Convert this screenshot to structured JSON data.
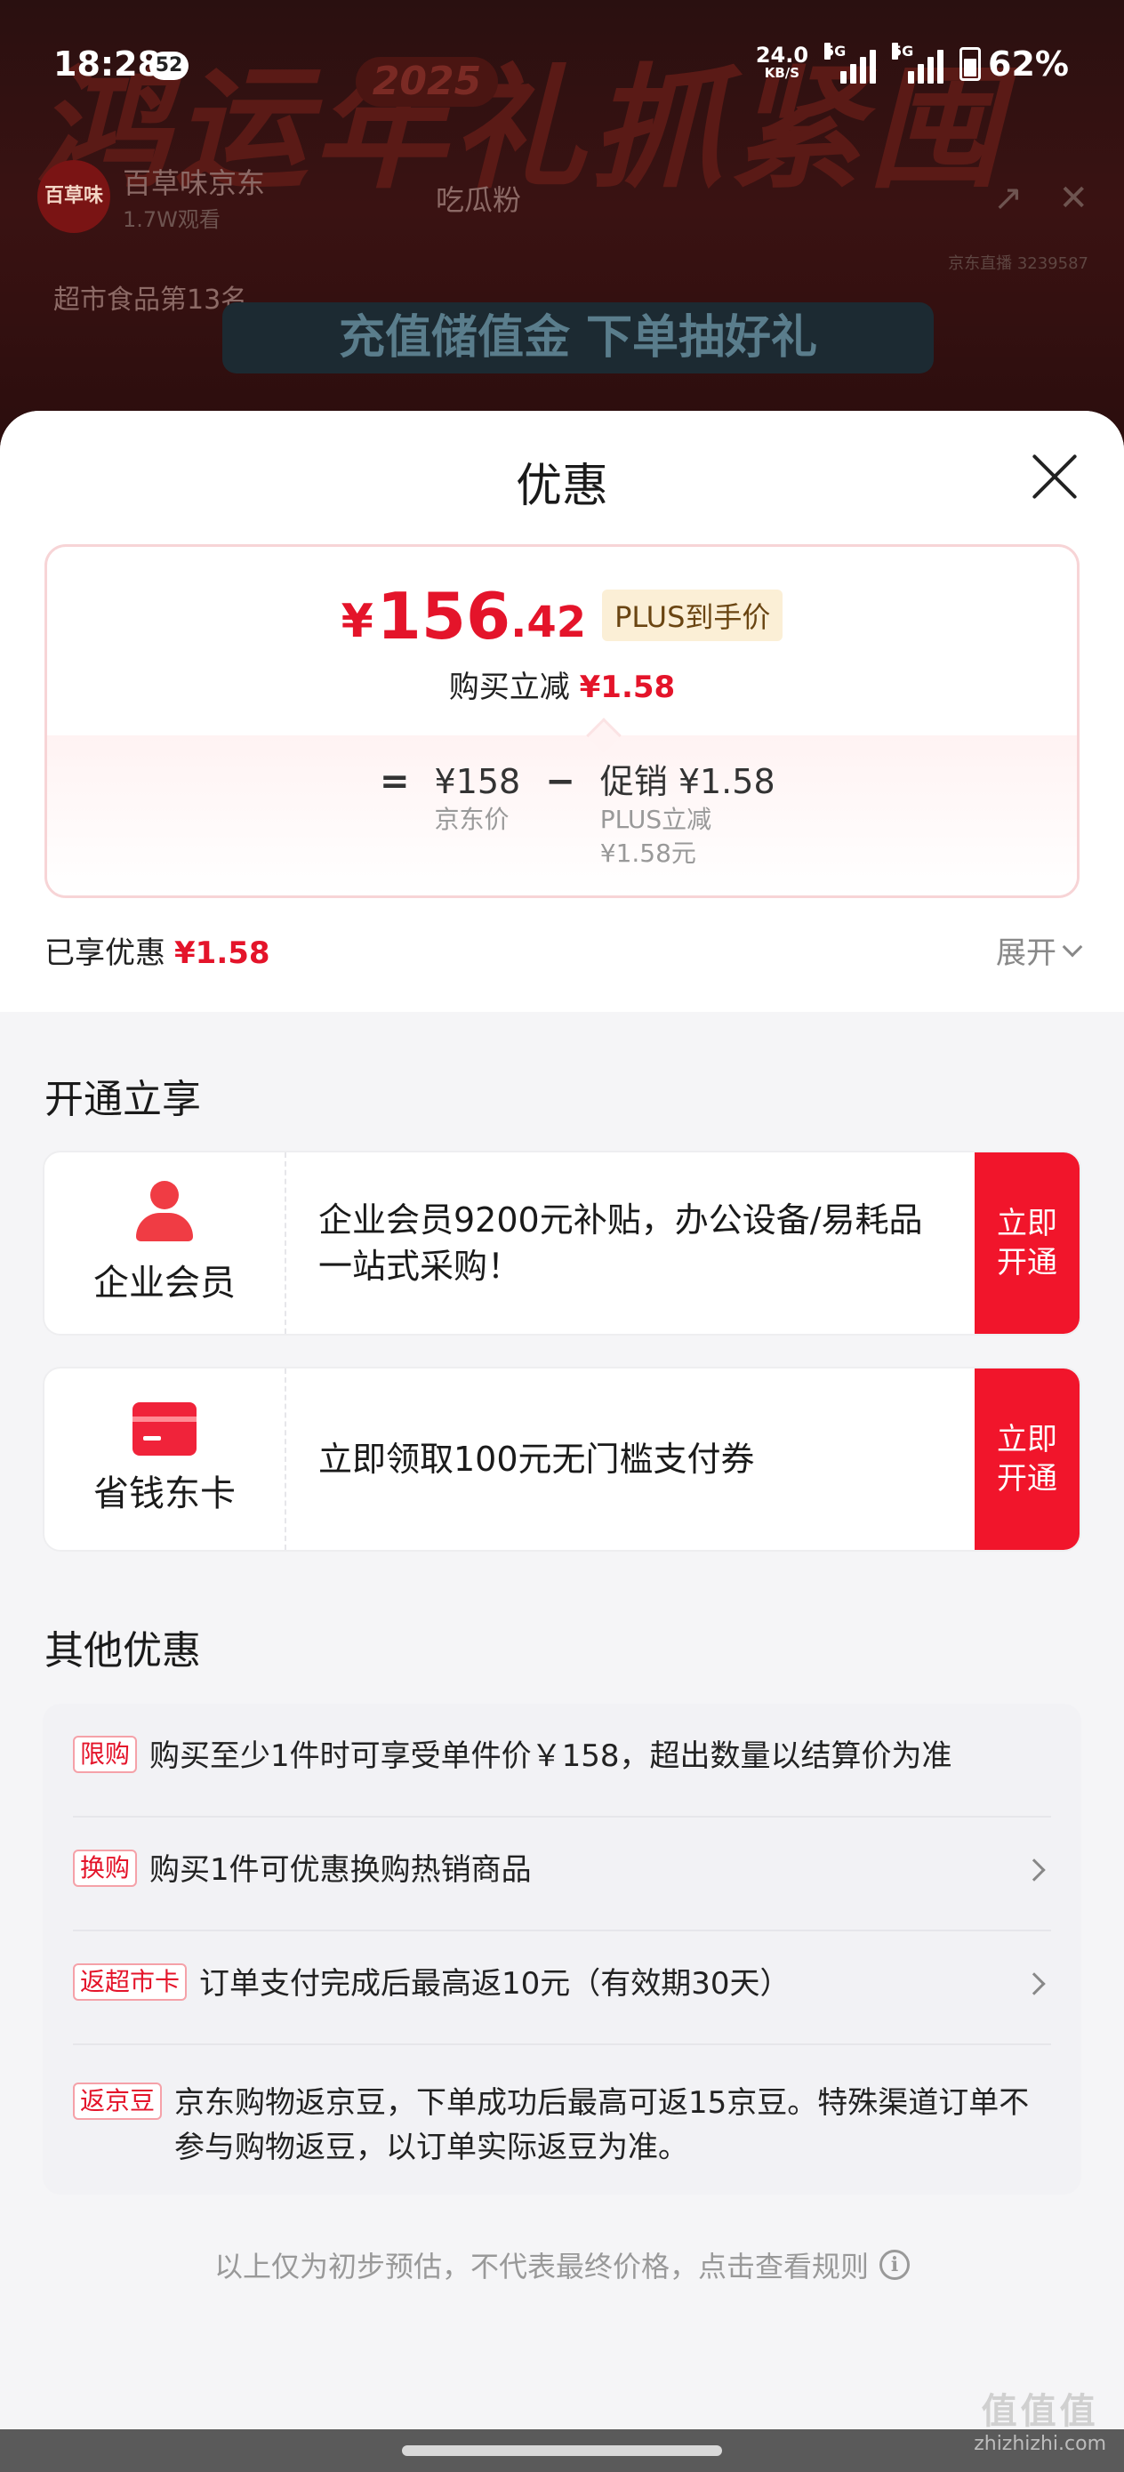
{
  "status_bar": {
    "time": "18:28",
    "notif_count": "52",
    "net_speed_value": "24.0",
    "net_speed_unit": "KB/S",
    "sim1_label": "5G",
    "sim2_label": "5G",
    "battery": "62%"
  },
  "background": {
    "banner_text": "鸿运年礼抓紧囤",
    "banner_year": "2025",
    "shop_logo_text": "百草味",
    "shop_name": "百草味京东",
    "viewers": "1.7W观看",
    "fans_label": "吃瓜粉",
    "stream_sub": "京东直播 3239587",
    "rank_label": "超市食品第13名",
    "promo_text": "充值储值金 下单抽好礼"
  },
  "sheet": {
    "title": "优惠",
    "price": {
      "yen": "¥",
      "integer": "156",
      "decimal": ".42",
      "tag": "PLUS到手价",
      "sub_label": "购买立减",
      "sub_amount": "¥1.58"
    },
    "formula": {
      "eq": "=",
      "base_value": "¥158",
      "base_label": "京东价",
      "minus": "−",
      "promo_value": "促销 ¥1.58",
      "promo_detail_1": "PLUS立减",
      "promo_detail_2": "¥1.58元"
    },
    "enjoyed_label": "已享优惠",
    "enjoyed_amount": "¥1.58",
    "expand_label": "展开"
  },
  "open_section": {
    "title": "开通立享",
    "cards": [
      {
        "icon": "person-icon",
        "name": "企业会员",
        "desc": "企业会员9200元补贴，办公设备/易耗品一站式采购！",
        "button": "立即开通"
      },
      {
        "icon": "card-icon",
        "name": "省钱东卡",
        "desc": "立即领取100元无门槛支付券",
        "button": "立即开通"
      }
    ]
  },
  "other_section": {
    "title": "其他优惠",
    "rows": [
      {
        "tag": "限购",
        "text": "购买至少1件时可享受单件价￥158，超出数量以结算价为准",
        "has_arrow": false
      },
      {
        "tag": "换购",
        "text": "购买1件可优惠换购热销商品",
        "has_arrow": true
      },
      {
        "tag": "返超市卡",
        "text": "订单支付完成后最高返10元（有效期30天）",
        "has_arrow": true
      },
      {
        "tag": "返京豆",
        "text": "京东购物返京豆，下单成功后最高可返15京豆。特殊渠道订单不参与购物返豆，以订单实际返豆为准。",
        "has_arrow": false
      }
    ]
  },
  "footer": {
    "note": "以上仅为初步预估，不代表最终价格，点击查看规则",
    "info_glyph": "i"
  },
  "watermark": {
    "big": "值值值",
    "url": "zhizhizhi.com"
  },
  "colors": {
    "accent_red": "#e4142a",
    "button_red": "#f1152b",
    "plus_tag_bg": "#fbefd6"
  }
}
